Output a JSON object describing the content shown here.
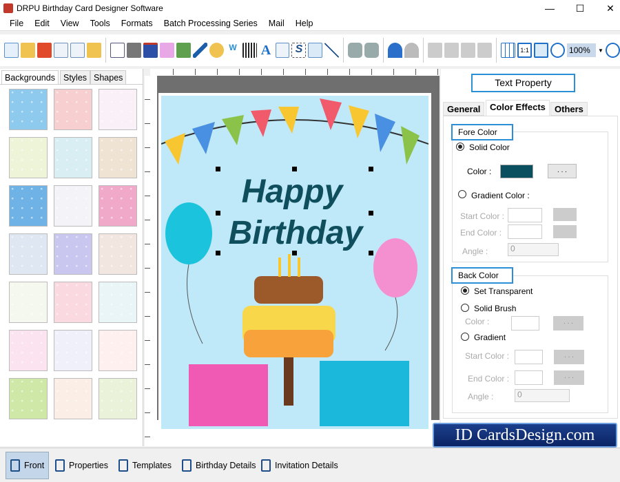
{
  "window": {
    "title": "DRPU Birthday Card Designer Software",
    "minimize": "—",
    "maximize": "☐",
    "close": "✕"
  },
  "menu": [
    "File",
    "Edit",
    "View",
    "Tools",
    "Formats",
    "Batch Processing Series",
    "Mail",
    "Help"
  ],
  "toolbar": {
    "zoom": "100%"
  },
  "left_tabs": [
    "Backgrounds",
    "Styles",
    "Shapes"
  ],
  "thumb_colors": [
    [
      "#8ec9ee",
      "#f7cfd0",
      "#f9f0f8"
    ],
    [
      "#eef4d8",
      "#d9eef3",
      "#efe4d4"
    ],
    [
      "#6fb3e6",
      "#f4f4f8",
      "#f0a9c8"
    ],
    [
      "#dfe7f2",
      "#c9c7f0",
      "#f2e7e0"
    ],
    [
      "#f4f8ef",
      "#fbd9e0",
      "#e9f5f7"
    ],
    [
      "#fbe4f0",
      "#f0f0fa",
      "#fff0f0"
    ],
    [
      "#cfe8a8",
      "#fbeee6",
      "#eaf3d9"
    ]
  ],
  "card": {
    "line1": "Happy",
    "line2": "Birthday",
    "text_color": "#0f4e5c",
    "bg": "#bfe8f8"
  },
  "right": {
    "title": "Text Property",
    "tabs": [
      "General",
      "Color Effects",
      "Others"
    ],
    "fore": {
      "legend": "Fore Color",
      "solid": "Solid Color",
      "color_label": "Color :",
      "color": "#0a4f5f",
      "browse": ". . .",
      "gradient": "Gradient Color :",
      "start": "Start Color :",
      "end": "End Color :",
      "angle": "Angle :",
      "angle_value": "0"
    },
    "back": {
      "legend": "Back Color",
      "transparent": "Set Transparent",
      "solid": "Solid Brush",
      "color_label": "Color :",
      "browse": ". . .",
      "gradient": "Gradient",
      "start": "Start Color :",
      "end": "End Color :",
      "angle": "Angle :",
      "angle_value": "0"
    }
  },
  "bottom": [
    "Front",
    "Properties",
    "Templates",
    "Birthday Details",
    "Invitation Details"
  ],
  "watermark": "ID CardsDesign.com"
}
